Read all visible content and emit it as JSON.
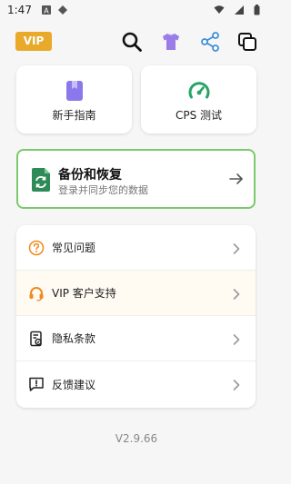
{
  "status_bar": {
    "time": "1:47"
  },
  "toolbar": {
    "vip_label": "VIP",
    "icons": [
      "search-icon",
      "shirt-icon",
      "share-icon",
      "copy-icon"
    ]
  },
  "features": [
    {
      "label": "新手指南",
      "icon": "bookmark-icon",
      "color": "#8b78ec"
    },
    {
      "label": "CPS 测试",
      "icon": "speedometer-icon",
      "color": "#27a466"
    }
  ],
  "backup": {
    "title": "备份和恢复",
    "subtitle": "登录并同步您的数据",
    "border_color": "#7cc96b"
  },
  "menu": {
    "items": [
      {
        "label": "常见问题",
        "icon": "question-icon"
      },
      {
        "label": "VIP 客户支持",
        "icon": "headset-icon"
      },
      {
        "label": "隐私条款",
        "icon": "privacy-doc-icon"
      },
      {
        "label": "反馈建议",
        "icon": "feedback-icon"
      }
    ]
  },
  "version": "V2.9.66",
  "colors": {
    "vip": "#e9a92a",
    "accent_orange": "#f08a1c",
    "accent_green": "#7cc96b"
  }
}
